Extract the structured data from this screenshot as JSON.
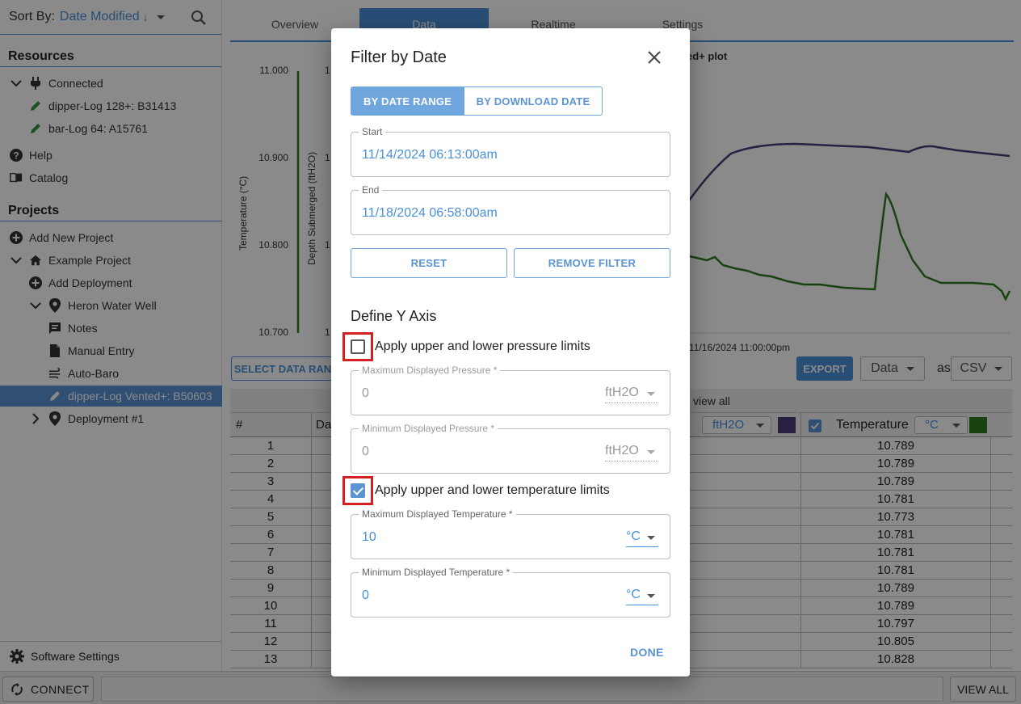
{
  "sidebar": {
    "sort_label": "Sort By:",
    "sort_value": "Date Modified",
    "sort_dir": "↓",
    "resources_title": "Resources",
    "resources": [
      "Connected",
      "dipper-Log 128+: B31413",
      "bar-Log 64: A15761",
      "Help",
      "Catalog"
    ],
    "projects_title": "Projects",
    "projects": [
      "Add New Project",
      "Example Project",
      "Add Deployment",
      "Heron Water Well",
      "Notes",
      "Manual Entry",
      "Auto-Baro",
      "dipper-Log Vented+: B50603",
      "Deployment #1"
    ],
    "settings_label": "Software Settings"
  },
  "main": {
    "tabs": [
      "Overview",
      "Data",
      "Realtime",
      "Settings"
    ],
    "active_tab": "Data",
    "chart_title_fragment": "ed+ plot",
    "y1_label": "Temperature (°C)",
    "y2_label": "Depth Submerged (ftH2O)",
    "y1_ticks": [
      "11.000",
      "10.900",
      "10.800",
      "10.700"
    ],
    "y2_tick_fragment": "1",
    "x_tick": "11/16/2024 11:00:00pm",
    "select_range_btn": "SELECT DATA RAN",
    "export_btn": "EXPORT",
    "export_type": "Data",
    "as_label": "as",
    "export_format": "CSV",
    "view_all_fragment": "view all",
    "col_num": "#",
    "col_date_fragment": "Da",
    "col_depth_unit": "ftH2O",
    "col_temp": "Temperature",
    "col_temp_unit": "°C",
    "depth_color": "#4b3a78",
    "temp_color": "#2e7d1e",
    "rows": [
      {
        "n": "1",
        "v": "10.789"
      },
      {
        "n": "2",
        "v": "10.789"
      },
      {
        "n": "3",
        "v": "10.789"
      },
      {
        "n": "4",
        "v": "10.781"
      },
      {
        "n": "5",
        "v": "10.773"
      },
      {
        "n": "6",
        "v": "10.781"
      },
      {
        "n": "7",
        "v": "10.781"
      },
      {
        "n": "8",
        "v": "10.781"
      },
      {
        "n": "9",
        "v": "10.789"
      },
      {
        "n": "10",
        "v": "10.789"
      },
      {
        "n": "11",
        "v": "10.797"
      },
      {
        "n": "12",
        "v": "10.805"
      },
      {
        "n": "13",
        "v": "10.828"
      }
    ]
  },
  "bottombar": {
    "connect_label": "CONNECT",
    "view_all_label": "VIEW ALL"
  },
  "dialog": {
    "title": "Filter by Date",
    "toggle_on": "BY DATE RANGE",
    "toggle_off": "BY DOWNLOAD DATE",
    "start_label": "Start",
    "start_value": "11/14/2024 06:13:00am",
    "end_label": "End",
    "end_value": "11/18/2024 06:58:00am",
    "reset_label": "RESET",
    "remove_label": "REMOVE FILTER",
    "y_axis_title": "Define Y Axis",
    "pressure_check_label": "Apply upper and lower pressure limits",
    "pressure_checked": false,
    "max_pressure_label": "Maximum Displayed Pressure *",
    "max_pressure_value": "0",
    "min_pressure_label": "Minimum Displayed Pressure *",
    "min_pressure_value": "0",
    "pressure_unit": "ftH2O",
    "temp_check_label": "Apply upper and lower temperature limits",
    "temp_checked": true,
    "max_temp_label": "Maximum Displayed Temperature *",
    "max_temp_value": "10",
    "min_temp_label": "Minimum Displayed Temperature *",
    "min_temp_value": "0",
    "temp_unit": "°C",
    "done_label": "DONE"
  }
}
